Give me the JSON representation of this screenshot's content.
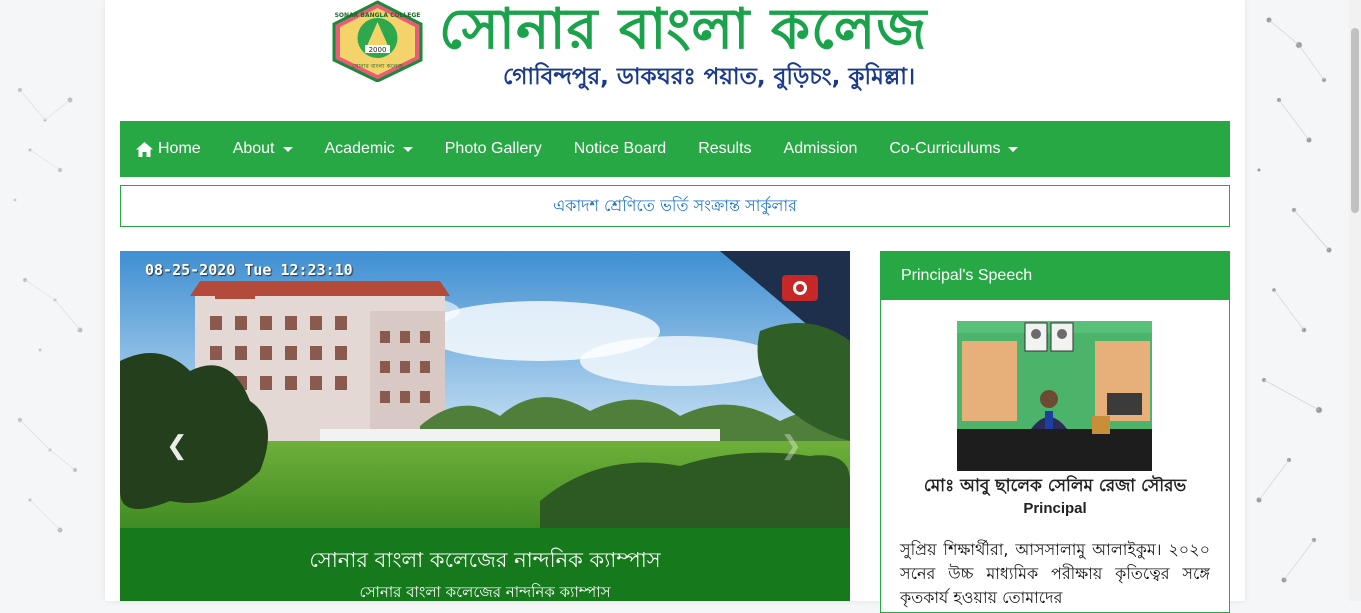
{
  "header": {
    "logo_text_top": "SONAR BANGLA COLLEGE",
    "logo_year": "2000",
    "logo_text_bottom": "সোনার বাংলা কলেজ",
    "college_name": "সোনার বাংলা কলেজ",
    "address": "গোবিন্দপুর, ডাকঘরঃ পয়াত, বুড়িচং, কুমিল্লা।"
  },
  "nav": {
    "items": [
      {
        "label": "Home",
        "icon": "home-icon",
        "dropdown": false
      },
      {
        "label": "About",
        "dropdown": true
      },
      {
        "label": "Academic",
        "dropdown": true
      },
      {
        "label": "Photo Gallery",
        "dropdown": false
      },
      {
        "label": "Notice Board",
        "dropdown": false
      },
      {
        "label": "Results",
        "dropdown": false
      },
      {
        "label": "Admission",
        "dropdown": false
      },
      {
        "label": "Co-Curriculums",
        "dropdown": true
      }
    ]
  },
  "notice": {
    "text": "একাদশ শ্রেণিতে ভর্তি সংক্রান্ত সার্কুলার"
  },
  "slider": {
    "timestamp": "08-25-2020 Tue 12:23:10",
    "caption_title": "সোনার বাংলা কলেজের নান্দনিক ক্যাম্পাস",
    "caption_sub": "সোনার বাংলা কলেজের নান্দনিক ক্যাম্পাস",
    "prev_icon": "chevron-left-icon",
    "next_icon": "chevron-right-icon"
  },
  "principal": {
    "header": "Principal's Speech",
    "name": "মোঃ আবু ছালেক সেলিম রেজা সৌরভ",
    "title": "Principal",
    "speech": "সুপ্রিয় শিক্ষার্থীরা, আসসালামু আলাইকুম। ২০২০ সনের উচ্চ মাধ্যমিক পরীক্ষায় কৃতিত্বের সঙ্গে কৃতকার্য হওয়ায় তোমাদের"
  },
  "colors": {
    "brand_green": "#28a745",
    "title_green": "#1aa34a",
    "address_blue": "#1b3a8c",
    "notice_blue": "#1a73c7",
    "caption_green": "#167a1d"
  }
}
